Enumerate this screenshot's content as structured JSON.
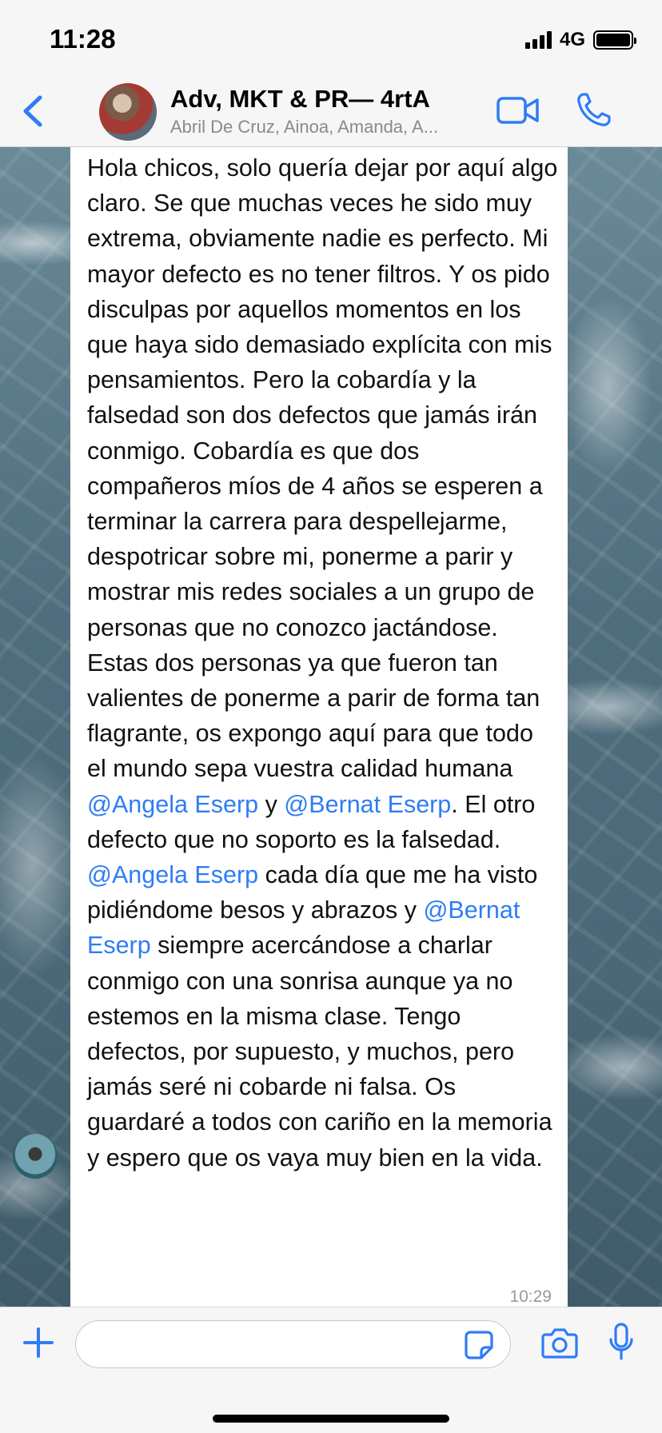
{
  "status_bar": {
    "time": "11:28",
    "network": "4G"
  },
  "header": {
    "title": "Adv, MKT & PR— 4rtA",
    "subtitle": "Abril De Cruz, Ainoa, Amanda, A...",
    "icons": {
      "back": "chevron-left-icon",
      "video": "video-camera-icon",
      "call": "phone-icon"
    },
    "accent_color": "#2f7cf6"
  },
  "message": {
    "segments": [
      {
        "text": "Hola chicos, solo quería dejar por aquí algo claro. Se que muchas veces he sido muy extrema, obviamente nadie es perfecto. Mi mayor defecto es no tener filtros. Y os pido disculpas por aquellos momentos en los que haya sido demasiado explícita con mis pensamientos. Pero la cobardía y la falsedad son dos defectos que jamás irán conmigo. Cobardía es que dos compañeros míos de 4 años se esperen a terminar la carrera para despellejarme, despotricar sobre mi, ponerme a parir y mostrar mis redes sociales a un grupo de personas que no conozco jactándose. Estas dos personas ya que fueron tan valientes de ponerme a parir de forma tan flagrante, os expongo aquí para que todo el mundo sepa vuestra calidad humana ",
        "mention": false
      },
      {
        "text": "@Angela Eserp",
        "mention": true
      },
      {
        "text": " y ",
        "mention": false
      },
      {
        "text": "@Bernat Eserp",
        "mention": true
      },
      {
        "text": ". El otro defecto que no soporto es la falsedad. ",
        "mention": false
      },
      {
        "text": "@Angela Eserp",
        "mention": true
      },
      {
        "text": " cada día que me ha visto pidiéndome besos y abrazos y ",
        "mention": false
      },
      {
        "text": "@Bernat Eserp",
        "mention": true
      },
      {
        "text": " siempre acercándose a charlar conmigo con una sonrisa aunque ya no estemos en la misma clase. Tengo defectos, por supuesto, y muchos, pero jamás seré ni cobarde ni falsa. Os guardaré a todos con cariño en la memoria y espero que os vaya muy bien en la vida.",
        "mention": false
      }
    ],
    "time": "10:29"
  },
  "input_bar": {
    "placeholder": "",
    "icons": {
      "add": "plus-icon",
      "sticker": "sticker-icon",
      "camera": "camera-icon",
      "mic": "microphone-icon"
    }
  }
}
